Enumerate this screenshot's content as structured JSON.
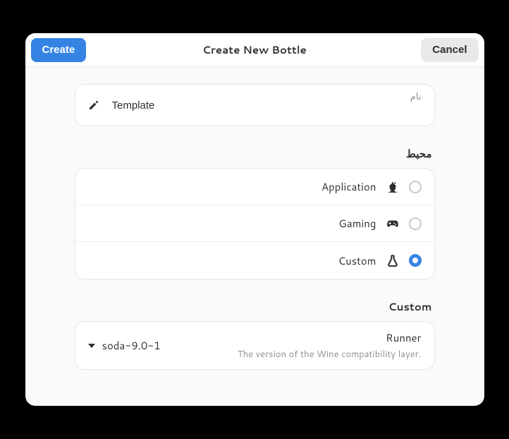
{
  "titlebar": {
    "create_label": "Create",
    "title": "Create New Bottle",
    "cancel_label": "Cancel"
  },
  "name_field": {
    "label": "نام",
    "value": "Template"
  },
  "environment": {
    "section_label": "محیط",
    "options": {
      "application": "Application",
      "gaming": "Gaming",
      "custom": "Custom"
    },
    "selected": "custom"
  },
  "custom": {
    "section_label": "Custom",
    "runner": {
      "title": "Runner",
      "subtitle": "The version of the Wine compatibility layer.",
      "value": "soda-9.0-1"
    }
  }
}
